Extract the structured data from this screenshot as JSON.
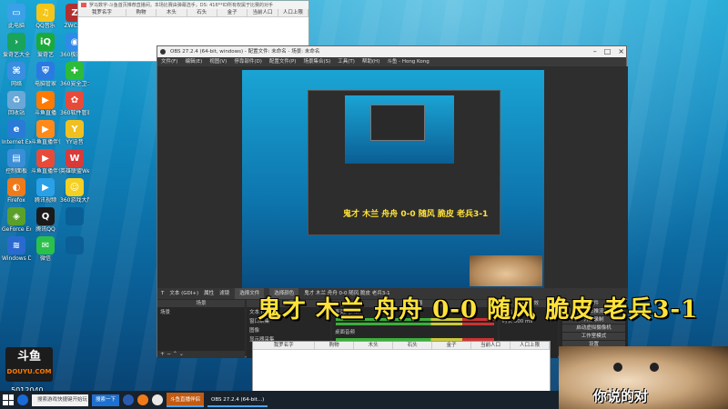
{
  "desktop_icons": [
    {
      "label": "此电脑",
      "color": "#3aa0e8",
      "glyph": "▭"
    },
    {
      "label": "QQ音乐",
      "color": "#f5c518",
      "glyph": "♫"
    },
    {
      "label": "ZWCAD",
      "color": "#b03030",
      "glyph": "Z"
    },
    {
      "label": "爱奇艺大全",
      "color": "#1aa35a",
      "glyph": "›"
    },
    {
      "label": "爱奇艺",
      "color": "#1aaa3a",
      "glyph": "iQ"
    },
    {
      "label": "360极速浏览器",
      "color": "#2f8ae8",
      "glyph": "◉"
    },
    {
      "label": "网络",
      "color": "#3a8ee0",
      "glyph": "⌘"
    },
    {
      "label": "电脑管家",
      "color": "#2a7ae2",
      "glyph": "⛨"
    },
    {
      "label": "360安全卫士",
      "color": "#2dbb3a",
      "glyph": "✚"
    },
    {
      "label": "回收站",
      "color": "#6aa8d8",
      "glyph": "♻"
    },
    {
      "label": "斗鱼直播",
      "color": "#ff7a00",
      "glyph": "▶"
    },
    {
      "label": "360软件管家",
      "color": "#e84a3a",
      "glyph": "✿"
    },
    {
      "label": "Internet Explorer",
      "color": "#2a7ad8",
      "glyph": "e"
    },
    {
      "label": "斗鱼直播伴侣",
      "color": "#ff8a1a",
      "glyph": "▶"
    },
    {
      "label": "YY语音",
      "color": "#f0c020",
      "glyph": "Y"
    },
    {
      "label": "控制面板",
      "color": "#3a8ed8",
      "glyph": "▤"
    },
    {
      "label": "斗鱼直播伴侣",
      "color": "#e84a3a",
      "glyph": "▶"
    },
    {
      "label": "英雄联盟WeGame",
      "color": "#d83a3a",
      "glyph": "W"
    },
    {
      "label": "Firefox",
      "color": "#f07a1a",
      "glyph": "◐"
    },
    {
      "label": "腾讯视频",
      "color": "#2aa0e8",
      "glyph": "▶"
    },
    {
      "label": "360游戏大厅",
      "color": "#f5d020",
      "glyph": "☺"
    },
    {
      "label": "GeForce Experience",
      "color": "#5aa02a",
      "glyph": "◈"
    },
    {
      "label": "腾讯QQ",
      "color": "#1a1a1a",
      "glyph": "Q"
    },
    {
      "label": "",
      "color": "#0a5f96",
      "glyph": ""
    },
    {
      "label": "Windows Defender",
      "color": "#2a6ad0",
      "glyph": "≋"
    },
    {
      "label": "微信",
      "color": "#2ac14a",
      "glyph": "✉"
    },
    {
      "label": "",
      "color": "#0a5f96",
      "glyph": ""
    }
  ],
  "sheet_top": {
    "title": "罗马数字-斗鱼首页推荐直播间，本场比赛由弹幕选手，DS: 416**ID所有权属于比赛的对手",
    "columns": [
      "我罗名字",
      "购物",
      "木头",
      "石头",
      "金子",
      "当前人口",
      "人口上限"
    ]
  },
  "obs": {
    "title": "OBS 27.2.4 (64-bit, windows) - 配置文件: 未命名 - 场景: 未命名",
    "menu": [
      "文件(F)",
      "编辑(E)",
      "视图(V)",
      "停靠部件(D)",
      "配置文件(P)",
      "场景集合(S)",
      "工具(T)",
      "帮助(H)",
      "斗鱼 - Hong Kong"
    ],
    "toolbar": {
      "source_name": "文本 (GDI+)",
      "props": "属性",
      "filters": "滤镜",
      "btn1": "选择文件",
      "btn2": "选择颜色",
      "text_preview": "鬼才 木兰 舟舟 0-0 随风 脆皮 老兵3-1"
    },
    "docks": {
      "scenes": {
        "title": "场景",
        "items": [
          "场景"
        ]
      },
      "sources": {
        "title": "来源",
        "items": [
          "文本 (GDI+)",
          "窗口采集",
          "图像",
          "显示器采集"
        ]
      },
      "mixer": {
        "title": "混音器",
        "items": [
          "麦克风/Aux",
          "桌面音频"
        ]
      },
      "transitions": {
        "title": "转场特效",
        "type": "淡出",
        "duration_label": "时长",
        "duration": "300 ms"
      },
      "controls": {
        "title": "控件",
        "buttons": [
          "停止推流",
          "开始录制",
          "启动虚拟摄像机",
          "工作室模式",
          "设置",
          "退出"
        ]
      }
    },
    "mini_caption": "鬼才 木兰 舟舟 0-0 随风 脆皮 老兵3-1"
  },
  "overlay_caption": "鬼才 木兰 舟舟 0-0 随风 脆皮 老兵3-1",
  "sheet_bottom": {
    "columns": [
      "我罗名字",
      "购物",
      "木头",
      "石头",
      "金子",
      "当前人口",
      "人口上限"
    ]
  },
  "douyu": {
    "mark": "斗鱼",
    "word": "DOUYU.COM",
    "room_id": "5012040"
  },
  "webcam": {
    "caption": "你说的对"
  },
  "taskbar": {
    "search_placeholder": "搜索游戏快捷键开始玩",
    "search_button": "搜索一下",
    "tasks": [
      "斗鱼直播伴侣",
      "OBS 27.2.4 (64-bit...)"
    ]
  }
}
